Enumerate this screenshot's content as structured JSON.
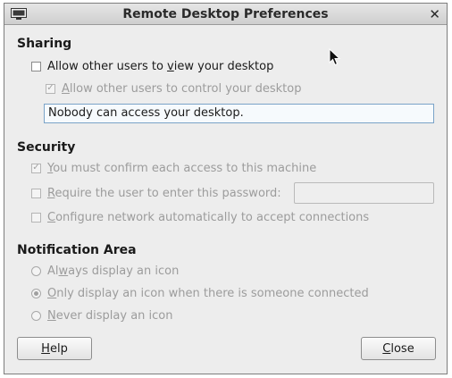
{
  "window": {
    "title": "Remote Desktop Preferences",
    "icon": "monitor-icon",
    "close_glyph": "✕"
  },
  "sharing": {
    "heading": "Sharing",
    "allow_view": {
      "pre": "Allow other users to ",
      "u": "v",
      "post": "iew your desktop",
      "checked": false,
      "enabled": true
    },
    "allow_control": {
      "pre": "",
      "u": "A",
      "post": "llow other users to control your desktop",
      "checked": true,
      "enabled": false
    },
    "status_text": "Nobody can access your desktop."
  },
  "security": {
    "heading": "Security",
    "confirm": {
      "pre": "",
      "u": "Y",
      "post": "ou must confirm each access to this machine",
      "checked": true,
      "enabled": false
    },
    "require_password": {
      "pre": "",
      "u": "R",
      "post": "equire the user to enter this password:",
      "checked": false,
      "enabled": false
    },
    "password_value": "",
    "configure_network": {
      "pre": "",
      "u": "C",
      "post": "onfigure network automatically to accept connections",
      "checked": false,
      "enabled": false
    }
  },
  "notification": {
    "heading": "Notification Area",
    "always": {
      "pre": "Al",
      "u": "w",
      "post": "ays display an icon",
      "selected": false
    },
    "only_connected": {
      "pre": "",
      "u": "O",
      "post": "nly display an icon when there is someone connected",
      "selected": true
    },
    "never": {
      "pre": "",
      "u": "N",
      "post": "ever display an icon",
      "selected": false
    }
  },
  "buttons": {
    "help": {
      "pre": "",
      "u": "H",
      "post": "elp"
    },
    "close": {
      "pre": "",
      "u": "C",
      "post": "lose"
    }
  },
  "colors": {
    "accent_border": "#7aa3c8",
    "disabled_text": "#9c9c9c"
  }
}
